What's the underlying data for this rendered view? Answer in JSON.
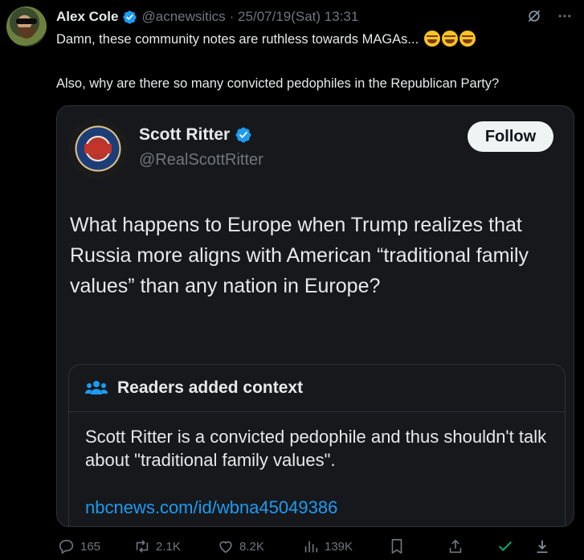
{
  "tweet": {
    "author_name": "Alex Cole",
    "author_handle": "@acnewsitics",
    "timestamp": "· 25/07/19(Sat) 13:31",
    "line1": "Damn, these community notes are ruthless towards MAGAs...",
    "line2": "Also, why are there so many convicted pedophiles in the Republican Party?",
    "emoji": "rolling-on-floor-laughing"
  },
  "quoted": {
    "author_name": "Scott Ritter",
    "author_handle": "@RealScottRitter",
    "follow_label": "Follow",
    "text": "What happens to Europe when Trump realizes that Russia more aligns with American “traditional family values” than any nation in Europe?",
    "note_title": "Readers added context",
    "note_text": "Scott Ritter is a convicted pedophile and thus shouldn't talk about \"traditional family values\".",
    "note_link": "nbcnews.com/id/wbna45049386"
  },
  "actions": {
    "replies": "165",
    "reposts": "2.1K",
    "likes": "8.2K",
    "views": "139K"
  },
  "colors": {
    "accent": "#1d9bf0",
    "verified": "#1d9bf0",
    "background": "#000000"
  }
}
